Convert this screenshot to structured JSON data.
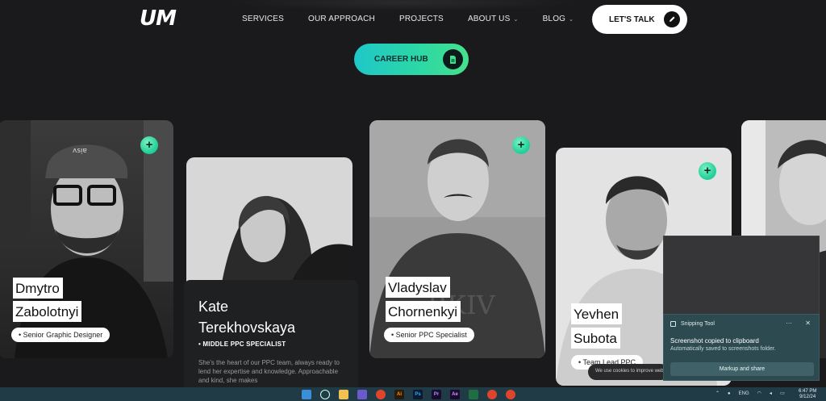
{
  "header": {
    "logo": "UM",
    "nav": [
      {
        "label": "SERVICES",
        "has_dropdown": false
      },
      {
        "label": "OUR APPROACH",
        "has_dropdown": false
      },
      {
        "label": "PROJECTS",
        "has_dropdown": false
      },
      {
        "label": "ABOUT US",
        "has_dropdown": true
      },
      {
        "label": "BLOG",
        "has_dropdown": true
      }
    ],
    "cta_label": "LET'S TALK",
    "cta_icon": "pencil-icon"
  },
  "career_hub": {
    "label": "CAREER HUB",
    "icon": "document-icon"
  },
  "team": [
    {
      "first": "Dmytro",
      "last": "Zabolotnyi",
      "role": "• Senior Graphic Designer"
    },
    {
      "first": "Kate",
      "last": "Terekhovskaya",
      "role": "• MIDDLE PPC SPECIALIST",
      "description": "She's the heart of our PPC team, always ready to lend her expertise and knowledge. Approachable and kind, she makes"
    },
    {
      "first": "Vladyslav",
      "last": "Chornenkyi",
      "role": "• Senior PPC Specialist"
    },
    {
      "first": "Yevhen",
      "last": "Subota",
      "role": "• Team Lead PPC"
    }
  ],
  "cookie_text": "We use cookies to improve website",
  "toast": {
    "app": "Snipping Tool",
    "heading": "Screenshot copied to clipboard",
    "subtext": "Automatically saved to screenshots folder.",
    "button": "Markup and share",
    "more": "···",
    "close": "✕"
  },
  "taskbar": {
    "tray_lang": "ENG",
    "time": "6:47 PM",
    "date": "9/12/24"
  },
  "colors": {
    "accent_from": "#1fc7c9",
    "accent_to": "#45e18c",
    "background": "#1a1a1c"
  }
}
